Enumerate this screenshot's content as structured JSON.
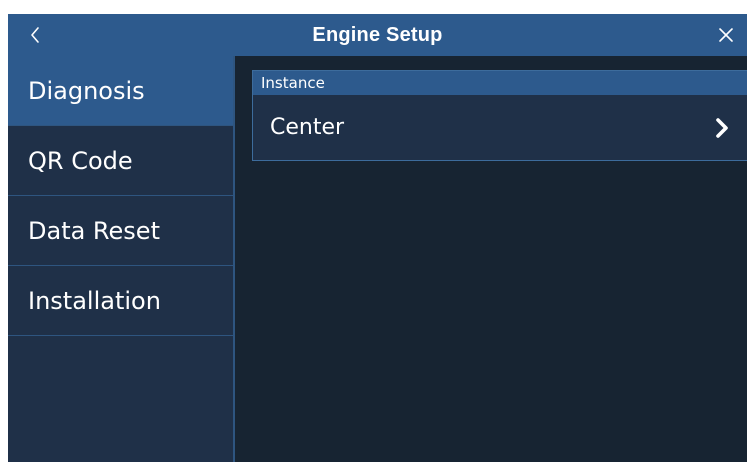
{
  "header": {
    "title": "Engine Setup",
    "back_icon": "chevron-left-icon",
    "close_icon": "close-icon"
  },
  "sidebar": {
    "items": [
      {
        "label": "Diagnosis",
        "active": true
      },
      {
        "label": "QR Code",
        "active": false
      },
      {
        "label": "Data Reset",
        "active": false
      },
      {
        "label": "Installation",
        "active": false
      }
    ]
  },
  "main": {
    "section": {
      "header": "Instance",
      "rows": [
        {
          "label": "Center",
          "icon": "chevron-right-icon"
        }
      ]
    }
  },
  "colors": {
    "title_bar": "#2d5a8d",
    "background": "#172432",
    "panel": "#1f3048",
    "border": "#2e5580",
    "text": "#ffffff"
  }
}
